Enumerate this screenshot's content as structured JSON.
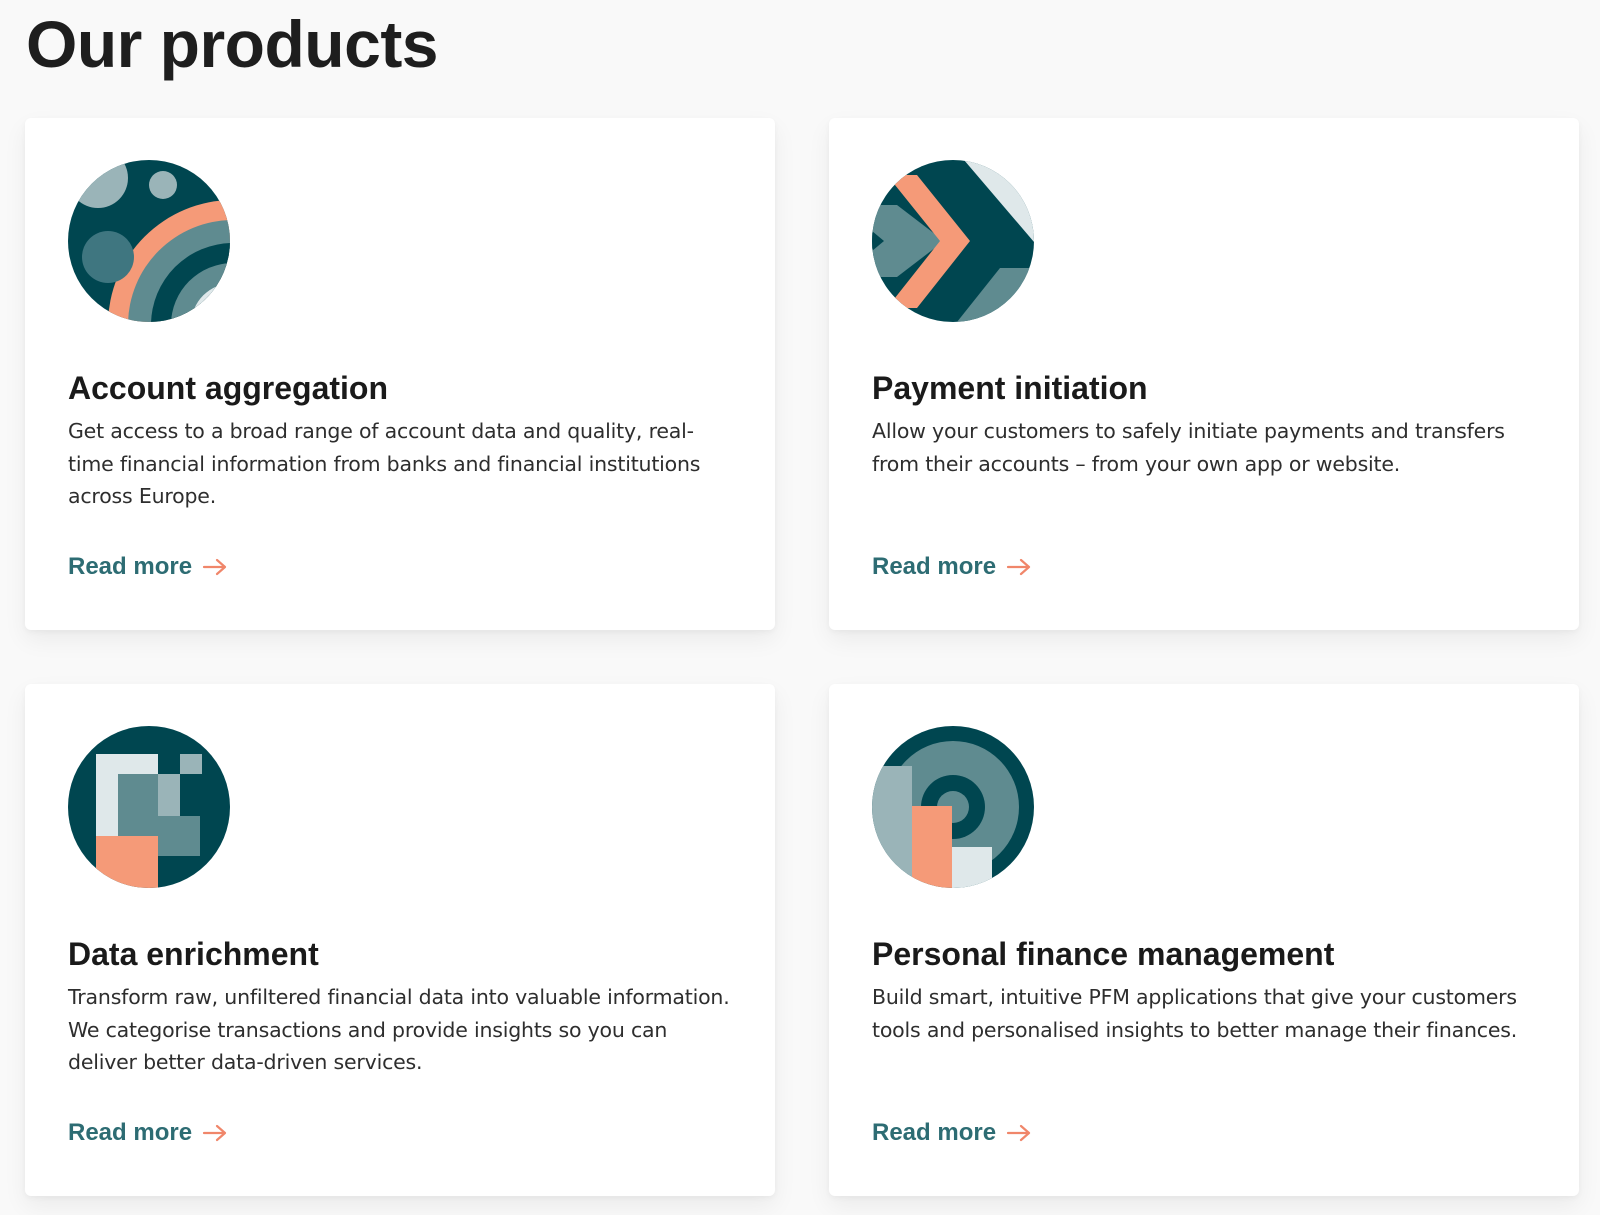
{
  "page": {
    "title": "Our products"
  },
  "colors": {
    "dark_teal": "#004650",
    "mid_teal": "#5f8b90",
    "light_teal": "#9ab4b8",
    "pale": "#dfe8ea",
    "coral": "#f59a78",
    "link": "#2d6c73",
    "arrow": "#f0866a"
  },
  "products": [
    {
      "title": "Account aggregation",
      "description": "Get access to a broad range of account data and quality, real-time financial information from banks and financial institutions across Europe.",
      "link_label": "Read more",
      "icon": "account-aggregation-illustration"
    },
    {
      "title": "Payment initiation",
      "description": "Allow your customers to safely initiate payments and transfers from their accounts  – from your own app or website.",
      "link_label": "Read more",
      "icon": "payment-initiation-illustration"
    },
    {
      "title": "Data enrichment",
      "description": "Transform raw, unfiltered financial data into valuable information. We categorise transactions and provide insights so you can deliver better data-driven services.",
      "link_label": "Read more",
      "icon": "data-enrichment-illustration"
    },
    {
      "title": "Personal finance management",
      "description": "Build smart, intuitive PFM applications that give your customers tools and personalised insights to better manage their finances.",
      "link_label": "Read more",
      "icon": "personal-finance-illustration"
    }
  ]
}
